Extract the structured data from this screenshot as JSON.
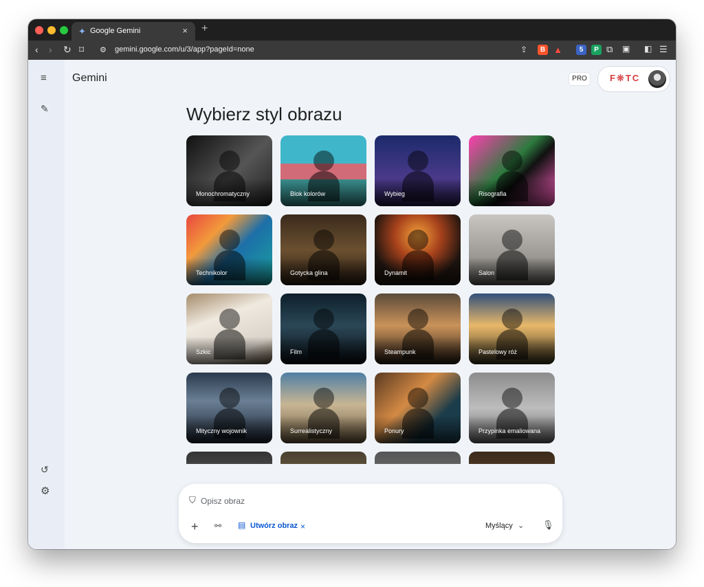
{
  "browser": {
    "tab_title": "Google Gemini",
    "tab_close": "×",
    "new_tab": "+",
    "url": "gemini.google.com/u/3/app?pageId=none"
  },
  "app": {
    "brand": "Gemini",
    "pro_badge": "PRO",
    "account_logo": "F❊TC",
    "heading": "Wybierz styl obrazu"
  },
  "styles": [
    {
      "label": "Monochromatyczny",
      "bg": "linear-gradient(135deg,#111,#555 55%,#222)"
    },
    {
      "label": "Blok kolorów",
      "bg": "linear-gradient(180deg,#3fb6c9 0 40%,#d26b78 40% 62%,#3a8f8f 62%)"
    },
    {
      "label": "Wybieg",
      "bg": "linear-gradient(180deg,#1c2a6b,#4a3a8a 60%,#2a1e4f)"
    },
    {
      "label": "Risografia",
      "bg": "linear-gradient(135deg,#ff3fb0,#2d7a3f 45%,#111 60%,#ff5fc0)"
    },
    {
      "label": "Technikolor",
      "bg": "linear-gradient(135deg,#e8463e,#f39a3c 30%,#1d6fa8 55%,#1aa3a0)"
    },
    {
      "label": "Gotycka glina",
      "bg": "linear-gradient(180deg,#3a2a1c,#6b5030 50%,#2a1d12)"
    },
    {
      "label": "Dynamit",
      "bg": "radial-gradient(circle at 50% 30%,#f3a23a,#a8421c 35%,#1e1510 70%)"
    },
    {
      "label": "Salon",
      "bg": "linear-gradient(180deg,#c9c6c2,#9b9894 60%,#5f5c59)"
    },
    {
      "label": "Szkic",
      "bg": "linear-gradient(160deg,#a58b6a,#efe9df 35%,#d8d2c8 75%,#6a5a45)"
    },
    {
      "label": "Film",
      "bg": "linear-gradient(180deg,#0d1f2a,#2b4757 45%,#0a1016)"
    },
    {
      "label": "Steampunk",
      "bg": "linear-gradient(180deg,#5b4a3a,#c9925a 45%,#2a1f16)"
    },
    {
      "label": "Pastelowy róż",
      "bg": "linear-gradient(180deg,#31507a,#e8b86a 45%,#3c3420)"
    },
    {
      "label": "Mityczny wojownik",
      "bg": "linear-gradient(180deg,#2a3a4d,#6a7f95 40%,#1b2430)"
    },
    {
      "label": "Surrealistyczny",
      "bg": "linear-gradient(180deg,#4f7fa3,#c8b594 45%,#6b5a3e)"
    },
    {
      "label": "Ponury",
      "bg": "linear-gradient(135deg,#5a3a22,#d48a44 40%,#1b3c4a 70%)"
    },
    {
      "label": "Przypinka emaliowana",
      "bg": "linear-gradient(180deg,#8c8c8c,#bdbdbd 50%,#6a6a6a)"
    },
    {
      "label": "",
      "bg": "linear-gradient(180deg,#333,#888)"
    },
    {
      "label": "",
      "bg": "linear-gradient(180deg,#4a4030,#a08860)"
    },
    {
      "label": "",
      "bg": "linear-gradient(180deg,#555,#999)"
    },
    {
      "label": "",
      "bg": "linear-gradient(180deg,#3a2a1a,#8a6a40)"
    }
  ],
  "composer": {
    "placeholder": "Opisz obraz",
    "chip_label": "Utwórz obraz",
    "chip_close": "×",
    "mode_label": "Myślący"
  }
}
